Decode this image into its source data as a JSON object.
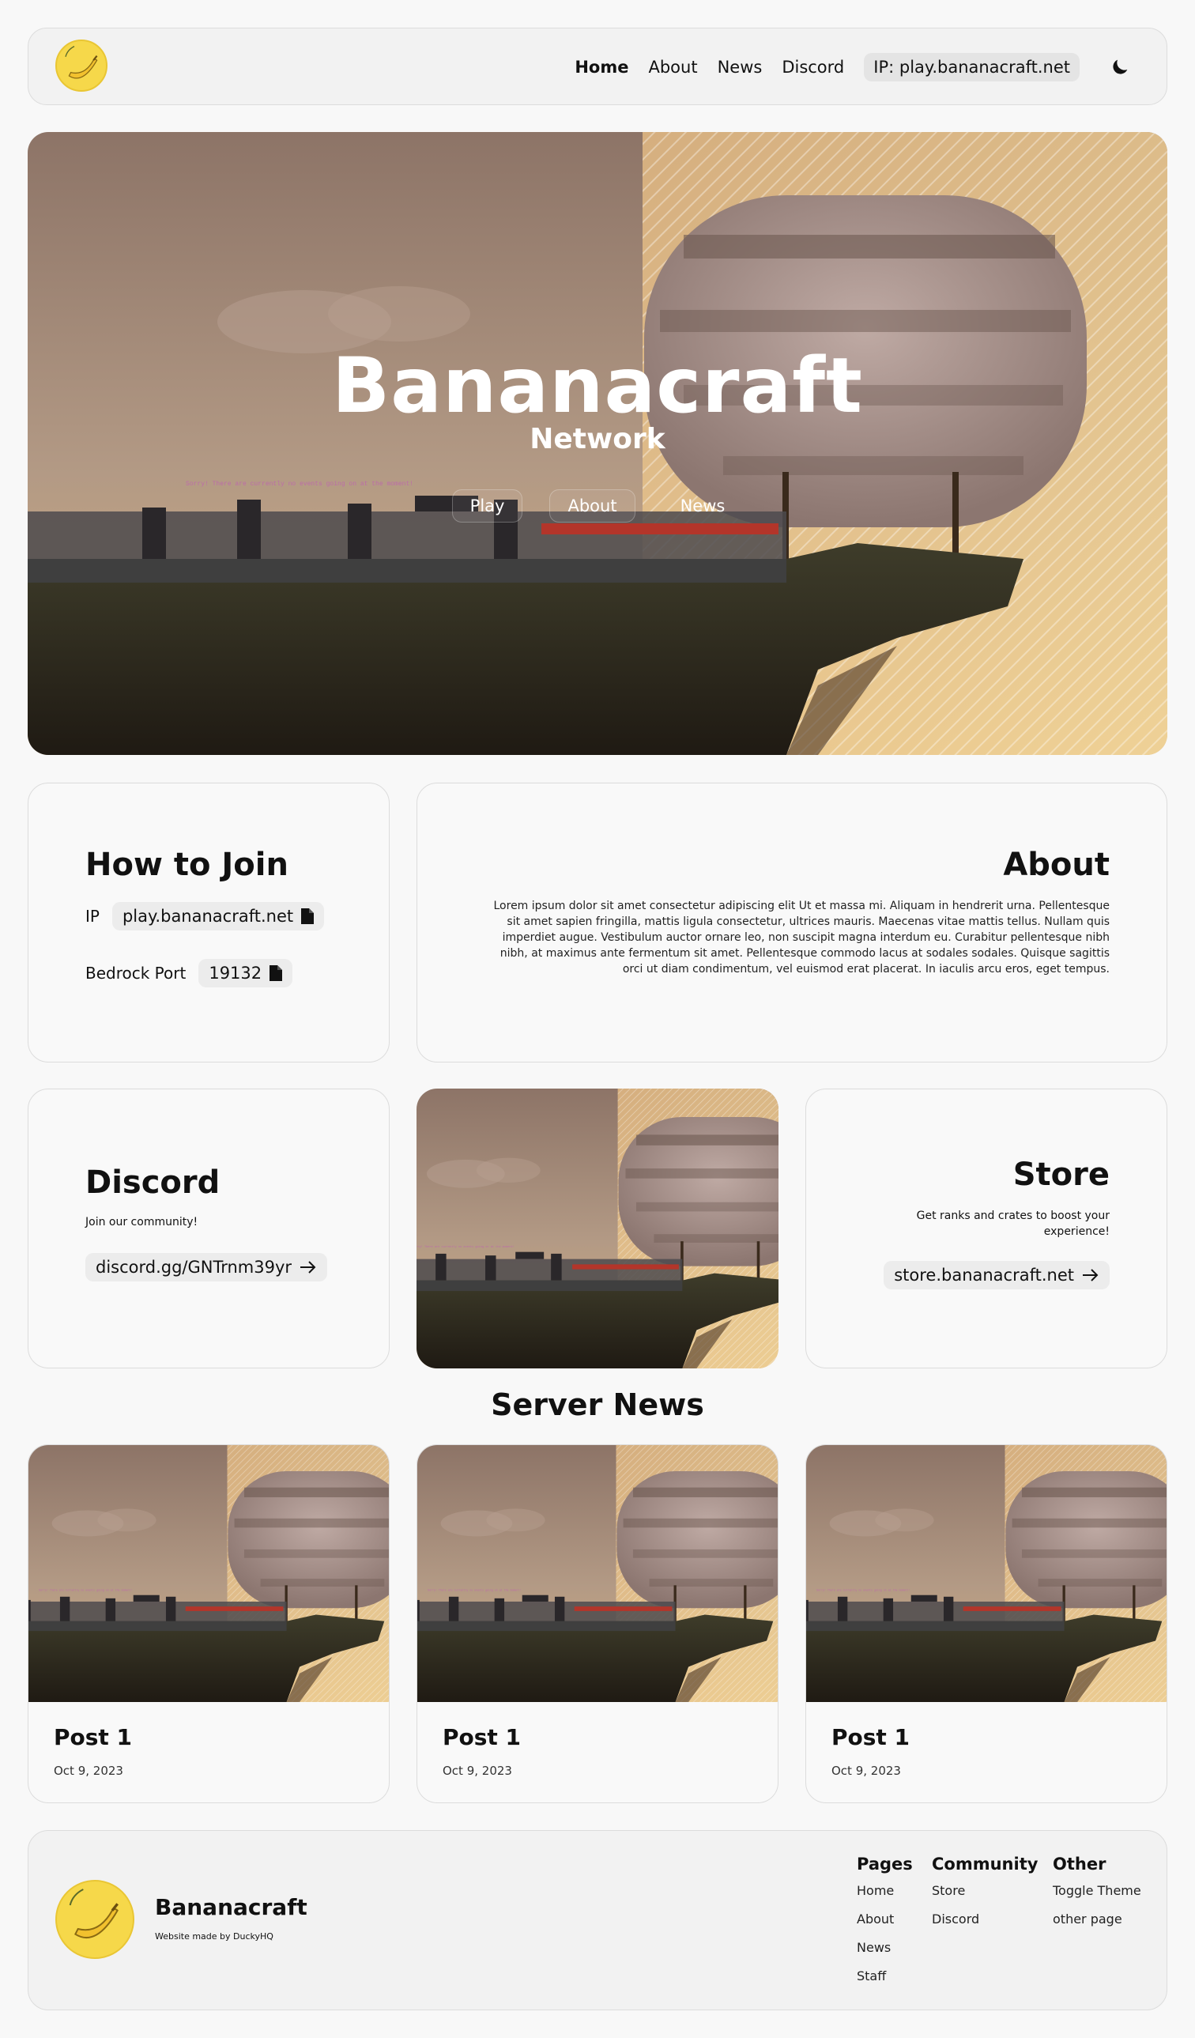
{
  "nav": {
    "links": [
      "Home",
      "About",
      "News",
      "Discord"
    ],
    "ip": "IP: play.bananacraft.net"
  },
  "hero": {
    "title": "Bananacraft",
    "subtitle": "Network",
    "buttons": [
      "Play",
      "About",
      "News"
    ],
    "scene_notice": "Sorry! There are currently no events going on at the moment!"
  },
  "join": {
    "title": "How to Join",
    "ip_label": "IP",
    "ip_value": "play.bananacraft.net",
    "port_label": "Bedrock Port",
    "port_value": "19132"
  },
  "about": {
    "title": "About",
    "body": "Lorem ipsum dolor sit amet consectetur adipiscing elit Ut et massa mi. Aliquam in hendrerit urna. Pellentesque sit amet sapien fringilla, mattis ligula consectetur, ultrices mauris. Maecenas vitae mattis tellus. Nullam quis imperdiet augue. Vestibulum auctor ornare leo, non suscipit magna interdum eu. Curabitur pellentesque nibh nibh, at maximus ante fermentum sit amet. Pellentesque commodo lacus at sodales sodales. Quisque sagittis orci ut diam condimentum, vel euismod erat placerat. In iaculis arcu eros, eget tempus."
  },
  "discord": {
    "title": "Discord",
    "subtitle": "Join our community!",
    "link": "discord.gg/GNTrnm39yr"
  },
  "store": {
    "title": "Store",
    "subtitle": "Get ranks and crates to boost your experience!",
    "link": "store.bananacraft.net"
  },
  "news": {
    "heading": "Server News",
    "posts": [
      {
        "title": "Post 1",
        "date": "Oct 9, 2023"
      },
      {
        "title": "Post 1",
        "date": "Oct 9, 2023"
      },
      {
        "title": "Post 1",
        "date": "Oct 9, 2023"
      }
    ]
  },
  "footer": {
    "brand": "Bananacraft",
    "credit": "Website made by DuckyHQ",
    "columns": [
      {
        "heading": "Pages",
        "links": [
          "Home",
          "About",
          "News",
          "Staff"
        ]
      },
      {
        "heading": "Community",
        "links": [
          "Store",
          "Discord"
        ]
      },
      {
        "heading": "Other",
        "links": [
          "Toggle Theme",
          "other page"
        ]
      }
    ]
  },
  "colors": {
    "accent_yellow": "#f6d84a",
    "page_bg": "#f8f8f8",
    "card_border": "#dcdcdc"
  },
  "icons": [
    "banana-logo-icon",
    "moon-icon",
    "file-icon",
    "arrow-right-icon"
  ]
}
